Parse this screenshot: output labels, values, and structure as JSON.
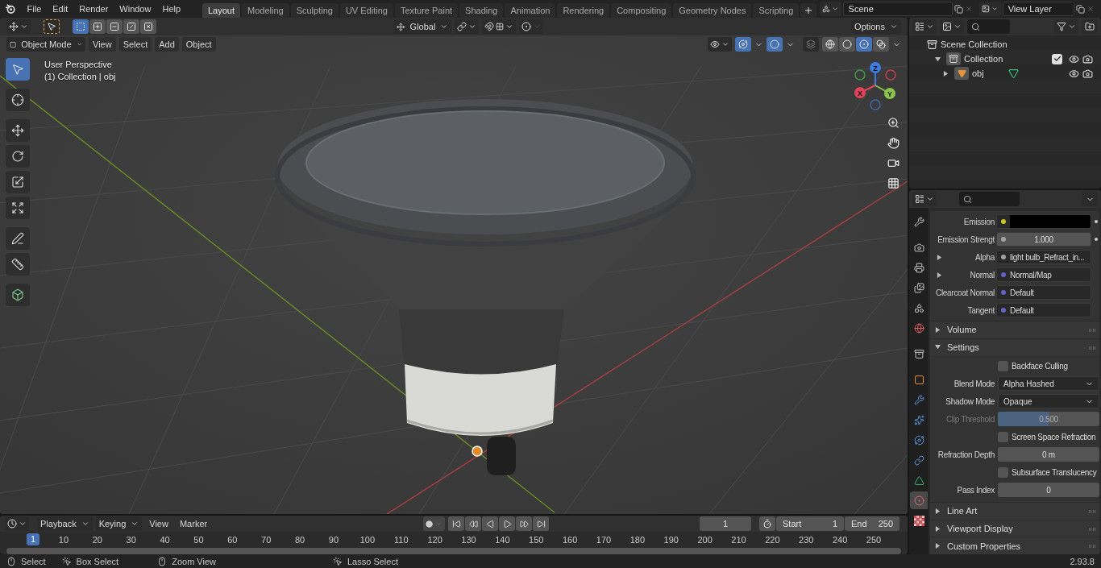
{
  "menu_bar": {
    "items": [
      "File",
      "Edit",
      "Render",
      "Window",
      "Help"
    ]
  },
  "workspace_tabs": [
    {
      "label": "Layout",
      "selected": true
    },
    {
      "label": "Modeling",
      "selected": false
    },
    {
      "label": "Sculpting",
      "selected": false
    },
    {
      "label": "UV Editing",
      "selected": false
    },
    {
      "label": "Texture Paint",
      "selected": false
    },
    {
      "label": "Shading",
      "selected": false
    },
    {
      "label": "Animation",
      "selected": false
    },
    {
      "label": "Rendering",
      "selected": false
    },
    {
      "label": "Compositing",
      "selected": false
    },
    {
      "label": "Geometry Nodes",
      "selected": false
    },
    {
      "label": "Scripting",
      "selected": false
    }
  ],
  "scene": {
    "name": "Scene"
  },
  "view_layer": {
    "name": "View Layer"
  },
  "viewport": {
    "select_modes": [
      {
        "kind": "set",
        "selected": true
      },
      {
        "kind": "extend",
        "selected": false
      },
      {
        "kind": "subtract",
        "selected": false
      },
      {
        "kind": "invert",
        "selected": false
      },
      {
        "kind": "intersect",
        "selected": false
      }
    ],
    "transform_orientation": "Global",
    "options": "Options",
    "mode": "Object Mode",
    "menus": [
      "View",
      "Select",
      "Add",
      "Object"
    ],
    "shading_modes": [
      {
        "kind": "wireframe",
        "selected": false
      },
      {
        "kind": "solid",
        "selected": false
      },
      {
        "kind": "material",
        "selected": true
      },
      {
        "kind": "rendered",
        "selected": false
      }
    ],
    "tools": [
      {
        "kind": "select",
        "selected": true
      },
      {
        "kind": "cursor",
        "selected": false
      },
      {
        "kind": "move",
        "selected": false
      },
      {
        "kind": "rotate",
        "selected": false
      },
      {
        "kind": "scale",
        "selected": false
      },
      {
        "kind": "transform",
        "selected": false
      },
      {
        "kind": "annotate",
        "selected": false
      },
      {
        "kind": "measure",
        "selected": false
      },
      {
        "kind": "add-cube",
        "selected": false
      }
    ],
    "overlay_lines": [
      "User Perspective",
      "(1) Collection | obj"
    ],
    "gizmo_axes": [
      "X",
      "Y",
      "Z"
    ]
  },
  "outliner": {
    "tree": [
      {
        "label": "Scene Collection",
        "kind": "scene",
        "children": [
          {
            "label": "Collection",
            "kind": "collection",
            "expanded": true,
            "checked": true,
            "children": [
              {
                "label": "obj",
                "kind": "object",
                "expanded": false
              }
            ]
          }
        ]
      }
    ]
  },
  "properties": {
    "tabs": [
      {
        "kind": "tool",
        "selected": false
      },
      {
        "kind": "render",
        "selected": false
      },
      {
        "kind": "output",
        "selected": false
      },
      {
        "kind": "view-layer",
        "selected": false
      },
      {
        "kind": "scene",
        "selected": false
      },
      {
        "kind": "world",
        "selected": false
      },
      {
        "kind": "collection",
        "selected": false
      },
      {
        "kind": "object",
        "selected": false
      },
      {
        "kind": "modifiers",
        "selected": false
      },
      {
        "kind": "particles",
        "selected": false
      },
      {
        "kind": "physics",
        "selected": false
      },
      {
        "kind": "constraints",
        "selected": false
      },
      {
        "kind": "data",
        "selected": false
      },
      {
        "kind": "material",
        "selected": true
      },
      {
        "kind": "texture",
        "selected": false
      }
    ],
    "inputs": [
      {
        "kind": "color",
        "label": "Emission",
        "color": "#c7c729"
      },
      {
        "kind": "value",
        "label": "Emission Strengt",
        "color": "#a1a1a1",
        "value": "1.000"
      },
      {
        "kind": "linked",
        "label": "Alpha",
        "color": "#a1a1a1",
        "value": "light bulb_Refract_in..."
      },
      {
        "kind": "linked",
        "label": "Normal",
        "color": "#6363c7",
        "value": "Normal/Map"
      },
      {
        "kind": "default",
        "label": "Clearcoat Normal",
        "color": "#6363c7",
        "value": "Default"
      },
      {
        "kind": "default",
        "label": "Tangent",
        "color": "#6363c7",
        "value": "Default"
      }
    ],
    "panels": [
      {
        "label": "Volume",
        "expanded": false
      },
      {
        "label": "Settings",
        "expanded": true,
        "fields": [
          {
            "kind": "checkbox",
            "label": "Backface Culling",
            "checked": false,
            "disabled": false
          },
          {
            "kind": "dropdown",
            "label": "Blend Mode",
            "value": "Alpha Hashed",
            "disabled": false
          },
          {
            "kind": "dropdown",
            "label": "Shadow Mode",
            "value": "Opaque",
            "disabled": false
          },
          {
            "kind": "slider",
            "label": "Clip Threshold",
            "value": "0.500",
            "level": 0.5,
            "disabled": true
          },
          {
            "kind": "checkbox",
            "label": "Screen Space Refraction",
            "checked": false,
            "disabled": false
          },
          {
            "kind": "number",
            "label": "Refraction Depth",
            "value": "0 m",
            "disabled": false
          },
          {
            "kind": "checkbox",
            "label": "Subsurface Translucency",
            "checked": false,
            "disabled": false
          },
          {
            "kind": "number",
            "label": "Pass Index",
            "value": "0",
            "disabled": false
          }
        ]
      },
      {
        "label": "Line Art",
        "expanded": false
      },
      {
        "label": "Viewport Display",
        "expanded": false
      },
      {
        "label": "Custom Properties",
        "expanded": false
      }
    ]
  },
  "timeline": {
    "menus": [
      "Playback",
      "Keying",
      "View",
      "Marker"
    ],
    "current_frame": "1",
    "start_label": "Start",
    "start": "1",
    "end_label": "End",
    "end": "250",
    "playhead": "1",
    "ticks": [
      "10",
      "20",
      "30",
      "40",
      "50",
      "60",
      "70",
      "80",
      "90",
      "100",
      "110",
      "120",
      "130",
      "140",
      "150",
      "160",
      "170",
      "180",
      "190",
      "200",
      "210",
      "220",
      "230",
      "240",
      "250"
    ]
  },
  "status_bar": {
    "hints": [
      {
        "kind": "click",
        "label": "Select"
      },
      {
        "kind": "drag",
        "label": "Box Select"
      },
      {
        "kind": "middle",
        "label": "Zoom View"
      },
      {
        "kind": "right-drag",
        "label": "Lasso Select"
      }
    ],
    "version": "2.93.8"
  }
}
